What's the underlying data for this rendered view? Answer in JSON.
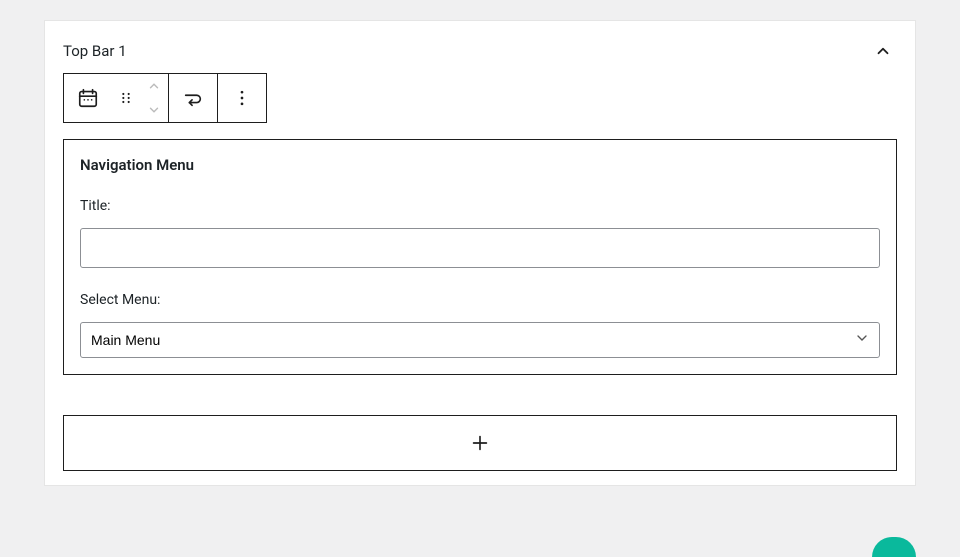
{
  "panel": {
    "title": "Top Bar 1"
  },
  "widget": {
    "heading": "Navigation Menu",
    "title_label": "Title:",
    "title_value": "",
    "select_label": "Select Menu:",
    "selected_menu": "Main Menu"
  },
  "icons": {
    "calendar": "calendar-icon",
    "drag": "drag-handle-icon",
    "move_up": "chevron-up",
    "move_down": "chevron-down",
    "transform": "transform-icon",
    "more": "more-vertical",
    "collapse": "chevron-up",
    "add": "plus",
    "select_chevron": "chevron-down"
  }
}
